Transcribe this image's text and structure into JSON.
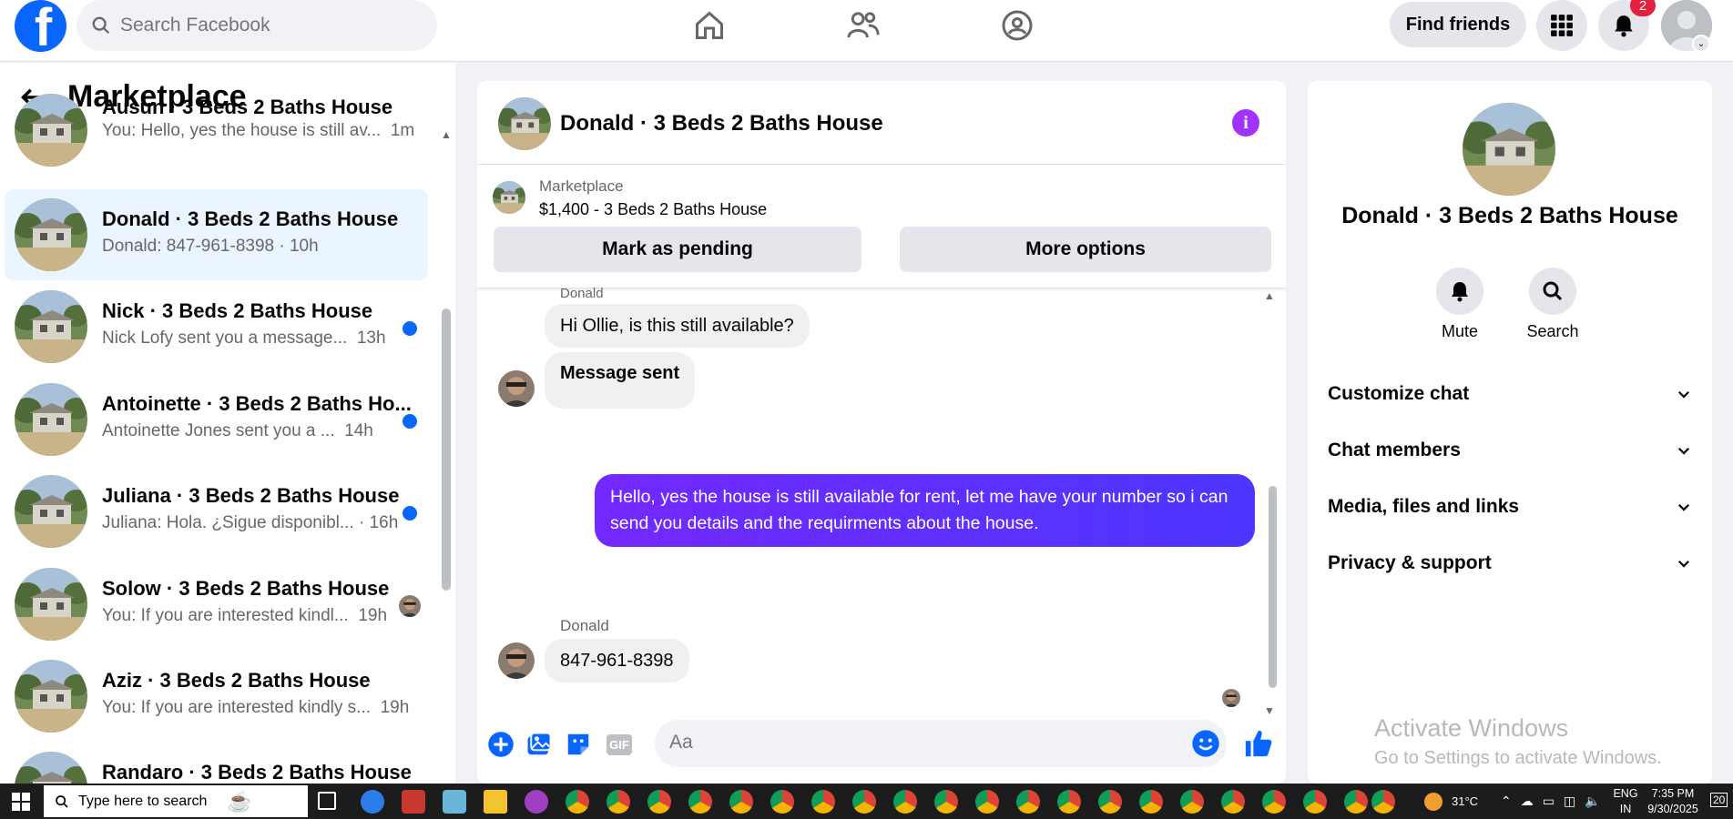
{
  "topbar": {
    "search_placeholder": "Search Facebook",
    "find_friends": "Find friends",
    "notification_count": "2"
  },
  "sidebar": {
    "title": "Marketplace",
    "conversations": [
      {
        "title": "Ausun · 3 Beds 2 Baths House",
        "preview": "You: Hello, yes the house is still av...",
        "time": "1m",
        "active": false
      },
      {
        "title": "Donald · 3 Beds 2 Baths House",
        "preview": "Donald: 847-961-8398 · 10h",
        "time": "",
        "active": true
      },
      {
        "title": "Nick · 3 Beds 2 Baths House",
        "preview": "Nick Lofy sent you a message...",
        "time": "13h",
        "unread": true
      },
      {
        "title": "Antoinette · 3 Beds 2 Baths Ho...",
        "preview": "Antoinette Jones sent you a ...",
        "time": "14h",
        "unread": true
      },
      {
        "title": "Juliana · 3 Beds 2 Baths House",
        "preview": "Juliana: Hola. ¿Sigue disponibl... · 16h",
        "time": "",
        "unread": true
      },
      {
        "title": "Solow · 3 Beds 2 Baths House",
        "preview": "You: If you are interested kindl...",
        "time": "19h",
        "unread": false
      },
      {
        "title": "Aziz · 3 Beds 2 Baths House",
        "preview": "You: If you are interested kindly s...",
        "time": "19h",
        "unread": false
      },
      {
        "title": "Randaro · 3 Beds 2 Baths House",
        "preview": "",
        "time": "",
        "unread": false
      }
    ]
  },
  "chat": {
    "name": "Donald · 3 Beds 2 Baths House",
    "listing_label": "Marketplace",
    "listing_price": "$1,400 - 3 Beds 2 Baths House",
    "mark_pending": "Mark as pending",
    "more_options": "More options",
    "sender_name": "Donald",
    "messages": {
      "m1": "Hi Ollie, is this still available?",
      "m2": "Message sent",
      "m3": "Hello, yes the house is still available for rent, let me have your number so i can send you details and the requirments about the house.",
      "m4": "847-961-8398"
    },
    "composer_placeholder": "Aa",
    "gif_label": "GIF"
  },
  "details": {
    "name": "Donald · 3 Beds 2 Baths House",
    "mute": "Mute",
    "search": "Search",
    "sections": [
      "Customize chat",
      "Chat members",
      "Media, files and links",
      "Privacy & support"
    ]
  },
  "watermark": {
    "line1": "Activate Windows",
    "line2": "Go to Settings to activate Windows."
  },
  "taskbar": {
    "search_placeholder": "Type here to search",
    "weather": "31°C",
    "lang": "ENG",
    "region": "IN",
    "time": "7:35 PM",
    "date": "9/30/2025",
    "notif_count": "20"
  },
  "colors": {
    "brand": "#0866ff",
    "outgoing_bubble_start": "#7328ff",
    "outgoing_bubble_end": "#4d36ff",
    "info": "#a033ff",
    "unread": "#0866ff"
  }
}
